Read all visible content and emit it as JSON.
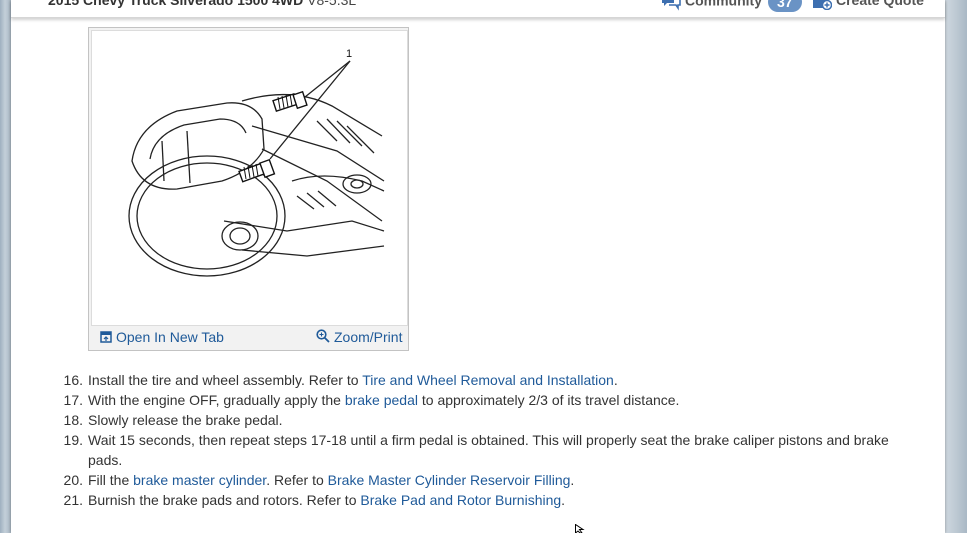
{
  "header": {
    "vehicle_title": "2015 Chevy Truck Silverado 1500 4WD",
    "engine": "V8-5.3L",
    "community_label": "Community",
    "community_count": "37",
    "create_quote_label": "Create Quote",
    "icons": {
      "community": "chat-bubbles-icon",
      "quote": "dollar-quote-icon"
    }
  },
  "figure": {
    "callout_label": "1",
    "open_new_tab_label": "Open In New Tab",
    "zoom_print_label": "Zoom/Print",
    "icons": {
      "open": "open-new-tab-icon",
      "zoom": "magnifier-icon"
    }
  },
  "steps": [
    {
      "number": "16.",
      "text_before": "Install the tire and wheel assembly. Refer to ",
      "link": "Tire and Wheel Removal and Installation",
      "text_mid": ".",
      "link2": "",
      "text_after": ""
    },
    {
      "number": "17.",
      "text_before": "With the engine OFF, gradually apply the ",
      "link": "brake pedal",
      "text_mid": " to approximately 2/3 of its travel distance.",
      "link2": "",
      "text_after": ""
    },
    {
      "number": "18.",
      "text_before": "Slowly release the brake pedal.",
      "link": "",
      "text_mid": "",
      "link2": "",
      "text_after": ""
    },
    {
      "number": "19.",
      "text_before": "Wait 15 seconds, then repeat steps 17-18 until a firm pedal is obtained. This will properly seat the brake caliper pistons and brake pads.",
      "link": "",
      "text_mid": "",
      "link2": "",
      "text_after": ""
    },
    {
      "number": "20.",
      "text_before": "Fill the ",
      "link": "brake master cylinder",
      "text_mid": ". Refer to ",
      "link2": "Brake Master Cylinder Reservoir Filling",
      "text_after": "."
    },
    {
      "number": "21.",
      "text_before": "Burnish the brake pads and rotors. Refer to ",
      "link": "Brake Pad and Rotor Burnishing",
      "text_mid": ".",
      "link2": "",
      "text_after": ""
    }
  ],
  "colors": {
    "link": "#1f5a99",
    "text": "#333333",
    "badge": "#6a93c5"
  }
}
